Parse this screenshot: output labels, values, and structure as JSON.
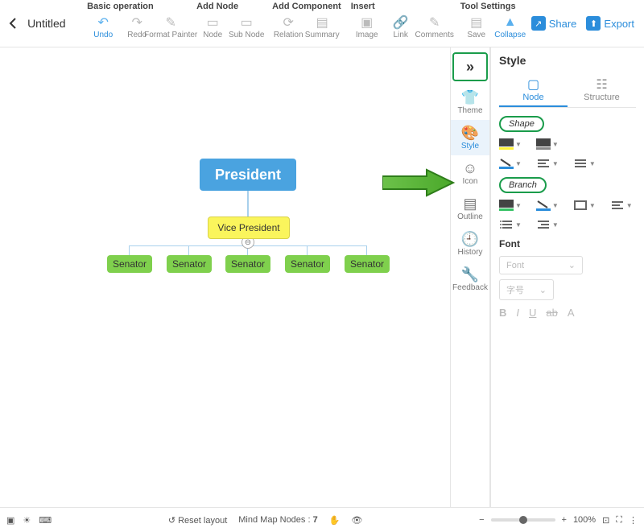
{
  "header": {
    "title": "Untitled",
    "groups": [
      {
        "title": "Basic operation",
        "items": [
          {
            "id": "undo",
            "label": "Undo",
            "color": "blue"
          },
          {
            "id": "redo",
            "label": "Redo",
            "color": "gray"
          },
          {
            "id": "format-painter",
            "label": "Format Painter",
            "color": "gray"
          }
        ]
      },
      {
        "title": "Add Node",
        "items": [
          {
            "id": "node",
            "label": "Node",
            "color": "gray"
          },
          {
            "id": "sub-node",
            "label": "Sub Node",
            "color": "gray"
          }
        ]
      },
      {
        "title": "Add Component",
        "items": [
          {
            "id": "relation",
            "label": "Relation",
            "color": "gray"
          },
          {
            "id": "summary",
            "label": "Summary",
            "color": "gray"
          }
        ]
      },
      {
        "title": "Insert",
        "items": [
          {
            "id": "image",
            "label": "Image",
            "color": "gray"
          },
          {
            "id": "link",
            "label": "Link",
            "color": "gray"
          },
          {
            "id": "comments",
            "label": "Comments",
            "color": "gray"
          }
        ]
      },
      {
        "title": "Tool Settings",
        "items": [
          {
            "id": "save",
            "label": "Save",
            "color": "gray"
          },
          {
            "id": "collapse",
            "label": "Collapse",
            "color": "blue"
          }
        ]
      }
    ],
    "share": "Share",
    "export": "Export"
  },
  "sidebar": {
    "items": [
      {
        "id": "theme",
        "label": "Theme"
      },
      {
        "id": "style",
        "label": "Style"
      },
      {
        "id": "icon",
        "label": "Icon"
      },
      {
        "id": "outline",
        "label": "Outline"
      },
      {
        "id": "history",
        "label": "History"
      },
      {
        "id": "feedback",
        "label": "Feedback"
      }
    ]
  },
  "panel": {
    "title": "Style",
    "tabs": [
      {
        "id": "node",
        "label": "Node"
      },
      {
        "id": "structure",
        "label": "Structure"
      }
    ],
    "shape_label": "Shape",
    "branch_label": "Branch",
    "font_label": "Font",
    "font_placeholder": "Font",
    "size_placeholder": "字号"
  },
  "diagram": {
    "president": "President",
    "vice_president": "Vice President",
    "senators": [
      "Senator",
      "Senator",
      "Senator",
      "Senator",
      "Senator"
    ]
  },
  "status": {
    "reset": "Reset layout",
    "nodes_label": "Mind Map Nodes :",
    "nodes_count": "7",
    "zoom": "100%"
  }
}
